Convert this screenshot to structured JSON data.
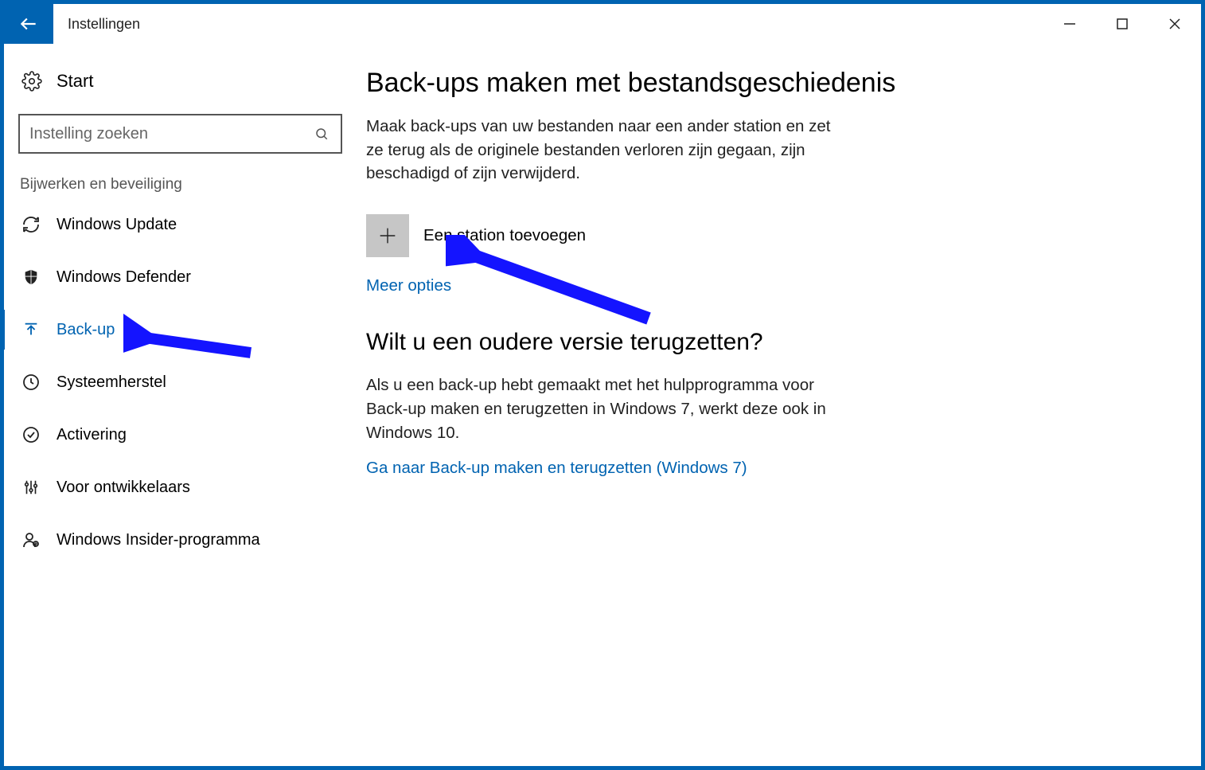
{
  "window": {
    "title": "Instellingen"
  },
  "sidebar": {
    "home": "Start",
    "search_placeholder": "Instelling zoeken",
    "section": "Bijwerken en beveiliging",
    "items": [
      {
        "icon": "refresh",
        "label": "Windows Update",
        "selected": false
      },
      {
        "icon": "shield",
        "label": "Windows Defender",
        "selected": false
      },
      {
        "icon": "upload",
        "label": "Back-up",
        "selected": true
      },
      {
        "icon": "history",
        "label": "Systeemherstel",
        "selected": false
      },
      {
        "icon": "check",
        "label": "Activering",
        "selected": false
      },
      {
        "icon": "sliders",
        "label": "Voor ontwikkelaars",
        "selected": false
      },
      {
        "icon": "person",
        "label": "Windows Insider-programma",
        "selected": false
      }
    ]
  },
  "main": {
    "heading1": "Back-ups maken met bestandsgeschiedenis",
    "paragraph1": "Maak back-ups van uw bestanden naar een ander station en zet ze terug als de originele bestanden verloren zijn gegaan, zijn beschadigd of zijn verwijderd.",
    "add_drive_label": "Een station toevoegen",
    "more_options": "Meer opties",
    "heading2": "Wilt u een oudere versie terugzetten?",
    "paragraph2": "Als u een back-up hebt gemaakt met het hulpprogramma voor Back-up maken en terugzetten in Windows 7, werkt deze ook in Windows 10.",
    "link_win7": "Ga naar Back-up maken en terugzetten (Windows 7)"
  }
}
